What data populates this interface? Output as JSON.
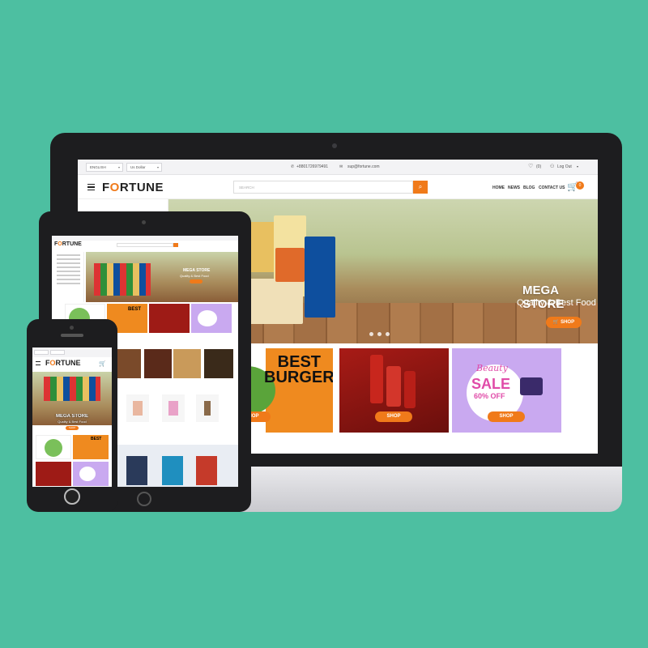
{
  "topbar": {
    "language": "ENGLISH",
    "currency": "Us Dollar",
    "phone": "+8801726979491",
    "email": "sup@fortune.com",
    "wishlist": "(0)",
    "account": "Log Out"
  },
  "header": {
    "logo_pre": "F",
    "logo_o": "O",
    "logo_post": "RTUNE",
    "search_placeholder": "SEARCH",
    "nav": [
      "HOME",
      "NEWS",
      "BLOG",
      "CONTACT US"
    ],
    "cart_count": "0"
  },
  "hero": {
    "title": "MEGA STORE",
    "subtitle": "Quality & Best Food",
    "button": "SHOP"
  },
  "banners": [
    {
      "title_line1": "BEST",
      "title_line2": "BURGER",
      "button": "SHOP"
    },
    {
      "button": "SHOP"
    },
    {
      "title_top": "Beauty",
      "title_main": "SALE",
      "title_sub": "60% OFF",
      "button": "SHOP"
    }
  ],
  "mobile": {
    "hero_title": "MEGA STORE",
    "hero_subtitle": "Quality & Best Food",
    "hero_button": "SHOP"
  },
  "colors": {
    "accent": "#f07a1a",
    "background": "#4dbfa1",
    "device": "#1d1d1f"
  },
  "icons": [
    "menu-icon",
    "search-icon",
    "heart-icon",
    "user-icon",
    "cart-icon",
    "phone-icon",
    "mail-icon"
  ]
}
